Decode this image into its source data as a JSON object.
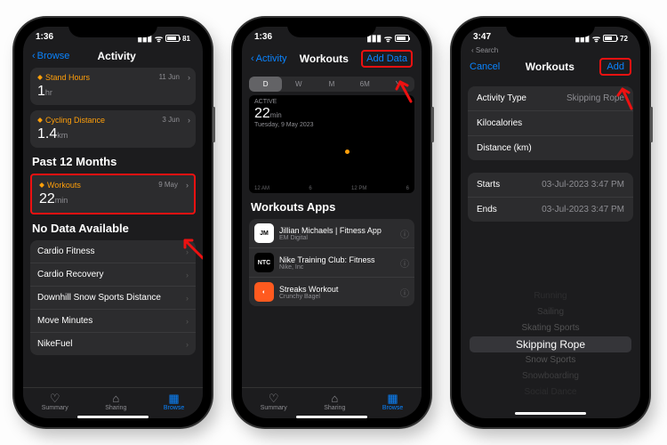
{
  "s1": {
    "time": "1:36",
    "battery": "81",
    "back": "Browse",
    "title": "Activity",
    "card1": {
      "label": "Stand Hours",
      "date": "11 Jun",
      "value": "1",
      "unit": "hr"
    },
    "card2": {
      "label": "Cycling Distance",
      "date": "3 Jun",
      "value": "1.4",
      "unit": "km"
    },
    "section1": "Past 12 Months",
    "card3": {
      "label": "Workouts",
      "date": "9 May",
      "value": "22",
      "unit": "min"
    },
    "section2": "No Data Available",
    "rows": [
      "Cardio Fitness",
      "Cardio Recovery",
      "Downhill Snow Sports Distance",
      "Move Minutes",
      "NikeFuel"
    ],
    "tabs": [
      "Summary",
      "Sharing",
      "Browse"
    ]
  },
  "s2": {
    "time": "1:36",
    "back": "Activity",
    "title": "Workouts",
    "action": "Add Data",
    "seg": [
      "D",
      "W",
      "M",
      "6M",
      "Y"
    ],
    "chart": {
      "label": "ACTIVE",
      "value": "22",
      "unit": "min",
      "sub": "Tuesday, 9 May 2023",
      "axis": [
        "12 AM",
        "6",
        "12 PM",
        "6"
      ]
    },
    "apps_h": "Workouts Apps",
    "apps": [
      {
        "name": "Jillian Michaels | Fitness App",
        "dev": "EM Digital",
        "bg": "#fff",
        "fg": "#000",
        "ic": "JM"
      },
      {
        "name": "Nike Training Club: Fitness",
        "dev": "Nike, Inc",
        "bg": "#000",
        "fg": "#fff",
        "ic": "NTC"
      },
      {
        "name": "Streaks Workout",
        "dev": "Crunchy Bagel",
        "bg": "#ff5a1f",
        "fg": "#fff",
        "ic": "◐"
      }
    ],
    "tabs": [
      "Summary",
      "Sharing",
      "Browse"
    ]
  },
  "s3": {
    "time": "3:47",
    "battery": "72",
    "searchback": "Search",
    "cancel": "Cancel",
    "title": "Workouts",
    "action": "Add",
    "rows1": [
      {
        "k": "Activity Type",
        "v": "Skipping Rope"
      },
      {
        "k": "Kilocalories",
        "v": ""
      },
      {
        "k": "Distance (km)",
        "v": ""
      }
    ],
    "rows2": [
      {
        "k": "Starts",
        "v": "03-Jul-2023  3:47 PM"
      },
      {
        "k": "Ends",
        "v": "03-Jul-2023  3:47 PM"
      }
    ],
    "picker": [
      "Running",
      "Sailing",
      "Skating Sports",
      "Skipping Rope",
      "Snow Sports",
      "Snowboarding",
      "Social Dance"
    ]
  }
}
